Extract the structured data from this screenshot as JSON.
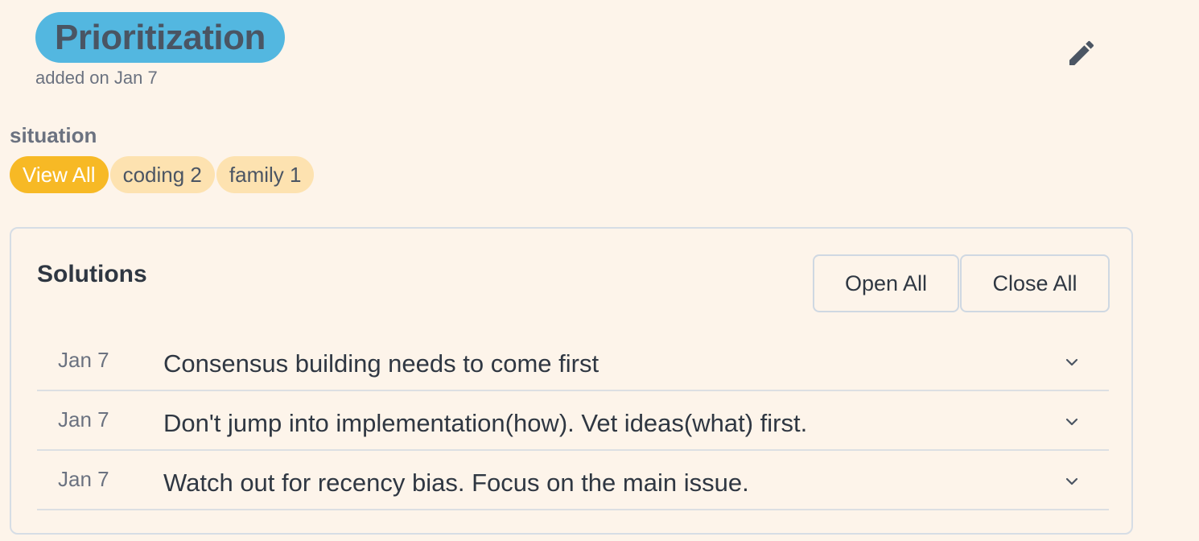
{
  "header": {
    "title": "Prioritization",
    "added": "added on Jan 7",
    "edit_icon": "pencil-icon"
  },
  "situation": {
    "label": "situation",
    "tags": [
      {
        "label": "View All",
        "active": true
      },
      {
        "label": "coding 2",
        "active": false
      },
      {
        "label": "family 1",
        "active": false
      }
    ]
  },
  "solutions": {
    "title": "Solutions",
    "open_all": "Open All",
    "close_all": "Close All",
    "items": [
      {
        "date": "Jan 7",
        "text": "Consensus building needs to come first"
      },
      {
        "date": "Jan 7",
        "text": "Don't jump into implementation(how). Vet ideas(what) first."
      },
      {
        "date": "Jan 7",
        "text": "Watch out for recency bias. Focus on the main issue."
      }
    ]
  },
  "colors": {
    "background": "#fdf4ea",
    "title_pill": "#53b7e0",
    "tag_active": "#f7b925",
    "tag_inactive": "#fde2b0"
  }
}
